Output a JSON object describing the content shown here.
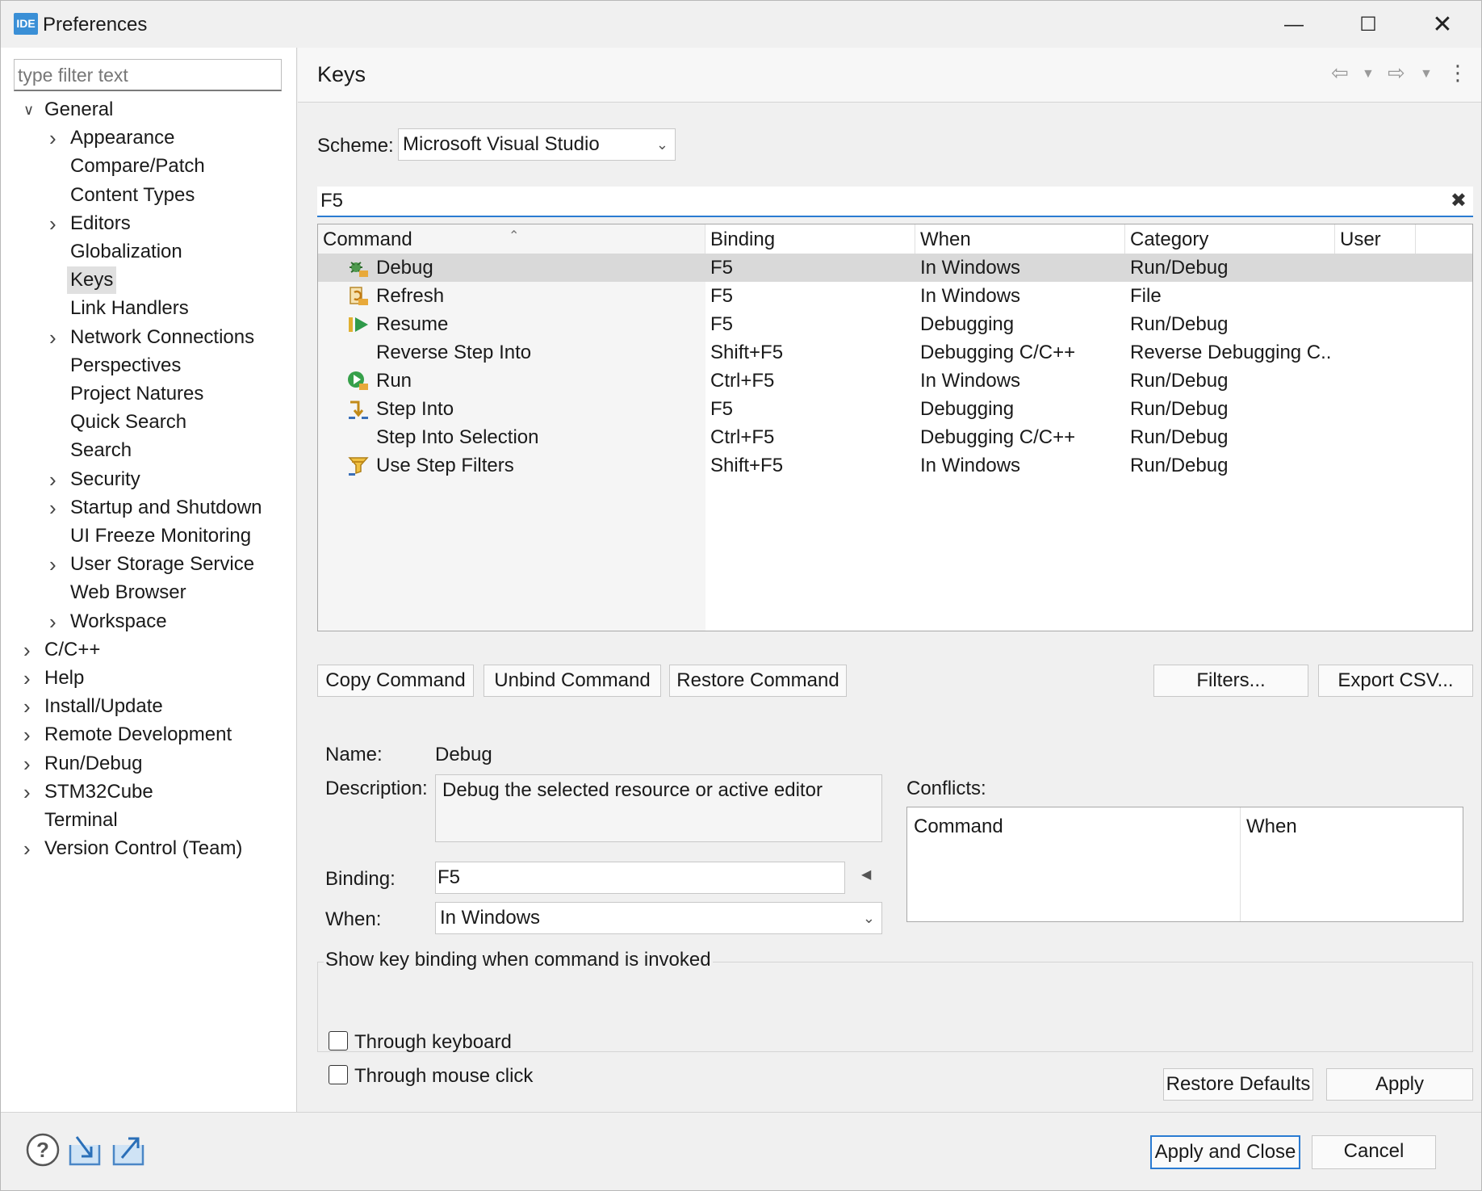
{
  "window": {
    "title": "Preferences",
    "icon_label": "IDE",
    "minimize_icon": "minimize-icon",
    "maximize_icon": "maximize-icon",
    "close_icon": "close-icon"
  },
  "sidebar": {
    "filter_placeholder": "type filter text",
    "tree": [
      {
        "label": "General",
        "expanded": true,
        "children": [
          {
            "label": "Appearance",
            "expandable": true
          },
          {
            "label": "Compare/Patch"
          },
          {
            "label": "Content Types"
          },
          {
            "label": "Editors",
            "expandable": true
          },
          {
            "label": "Globalization"
          },
          {
            "label": "Keys",
            "selected": true
          },
          {
            "label": "Link Handlers"
          },
          {
            "label": "Network Connections",
            "expandable": true
          },
          {
            "label": "Perspectives"
          },
          {
            "label": "Project Natures"
          },
          {
            "label": "Quick Search"
          },
          {
            "label": "Search"
          },
          {
            "label": "Security",
            "expandable": true
          },
          {
            "label": "Startup and Shutdown",
            "expandable": true
          },
          {
            "label": "UI Freeze Monitoring"
          },
          {
            "label": "User Storage Service",
            "expandable": true
          },
          {
            "label": "Web Browser"
          },
          {
            "label": "Workspace",
            "expandable": true
          }
        ]
      },
      {
        "label": "C/C++",
        "expandable": true
      },
      {
        "label": "Help",
        "expandable": true
      },
      {
        "label": "Install/Update",
        "expandable": true
      },
      {
        "label": "Remote Development",
        "expandable": true
      },
      {
        "label": "Run/Debug",
        "expandable": true
      },
      {
        "label": "STM32Cube",
        "expandable": true
      },
      {
        "label": "Terminal"
      },
      {
        "label": "Version Control (Team)",
        "expandable": true
      }
    ]
  },
  "page": {
    "title": "Keys",
    "scheme_label": "Scheme:",
    "scheme_value": "Microsoft Visual Studio",
    "search_value": "F5",
    "table": {
      "columns": [
        "Command",
        "Binding",
        "When",
        "Category",
        "User"
      ],
      "rows": [
        {
          "icon": "debug-icon",
          "command": "Debug",
          "binding": "F5",
          "when": "In Windows",
          "category": "Run/Debug",
          "user": "",
          "selected": true
        },
        {
          "icon": "refresh-icon",
          "command": "Refresh",
          "binding": "F5",
          "when": "In Windows",
          "category": "File",
          "user": ""
        },
        {
          "icon": "resume-icon",
          "command": "Resume",
          "binding": "F5",
          "when": "Debugging",
          "category": "Run/Debug",
          "user": ""
        },
        {
          "icon": "",
          "command": "Reverse Step Into",
          "binding": "Shift+F5",
          "when": "Debugging C/C++",
          "category": "Reverse Debugging C...",
          "user": ""
        },
        {
          "icon": "run-icon",
          "command": "Run",
          "binding": "Ctrl+F5",
          "when": "In Windows",
          "category": "Run/Debug",
          "user": ""
        },
        {
          "icon": "step-into-icon",
          "command": "Step Into",
          "binding": "F5",
          "when": "Debugging",
          "category": "Run/Debug",
          "user": ""
        },
        {
          "icon": "",
          "command": "Step Into Selection",
          "binding": "Ctrl+F5",
          "when": "Debugging C/C++",
          "category": "Run/Debug",
          "user": ""
        },
        {
          "icon": "step-filters-icon",
          "command": "Use Step Filters",
          "binding": "Shift+F5",
          "when": "In Windows",
          "category": "Run/Debug",
          "user": ""
        }
      ]
    },
    "buttons": {
      "copy_command": "Copy Command",
      "unbind_command": "Unbind Command",
      "restore_command": "Restore Command",
      "filters": "Filters...",
      "export_csv": "Export CSV..."
    },
    "details": {
      "name_label": "Name:",
      "name_value": "Debug",
      "description_label": "Description:",
      "description_value": "Debug the selected resource or active editor",
      "binding_label": "Binding:",
      "binding_value": "F5",
      "when_label": "When:",
      "when_value": "In Windows",
      "conflicts_label": "Conflicts:",
      "conflicts_columns": [
        "Command",
        "When"
      ]
    },
    "show_binding": {
      "title": "Show key binding when command is invoked",
      "through_keyboard": "Through keyboard",
      "through_keyboard_checked": false,
      "through_mouse": "Through mouse click",
      "through_mouse_checked": false
    },
    "restore_defaults": "Restore Defaults",
    "apply": "Apply"
  },
  "footer": {
    "apply_and_close": "Apply and Close",
    "cancel": "Cancel",
    "icons": [
      "help-icon",
      "import-icon",
      "export-icon"
    ]
  }
}
